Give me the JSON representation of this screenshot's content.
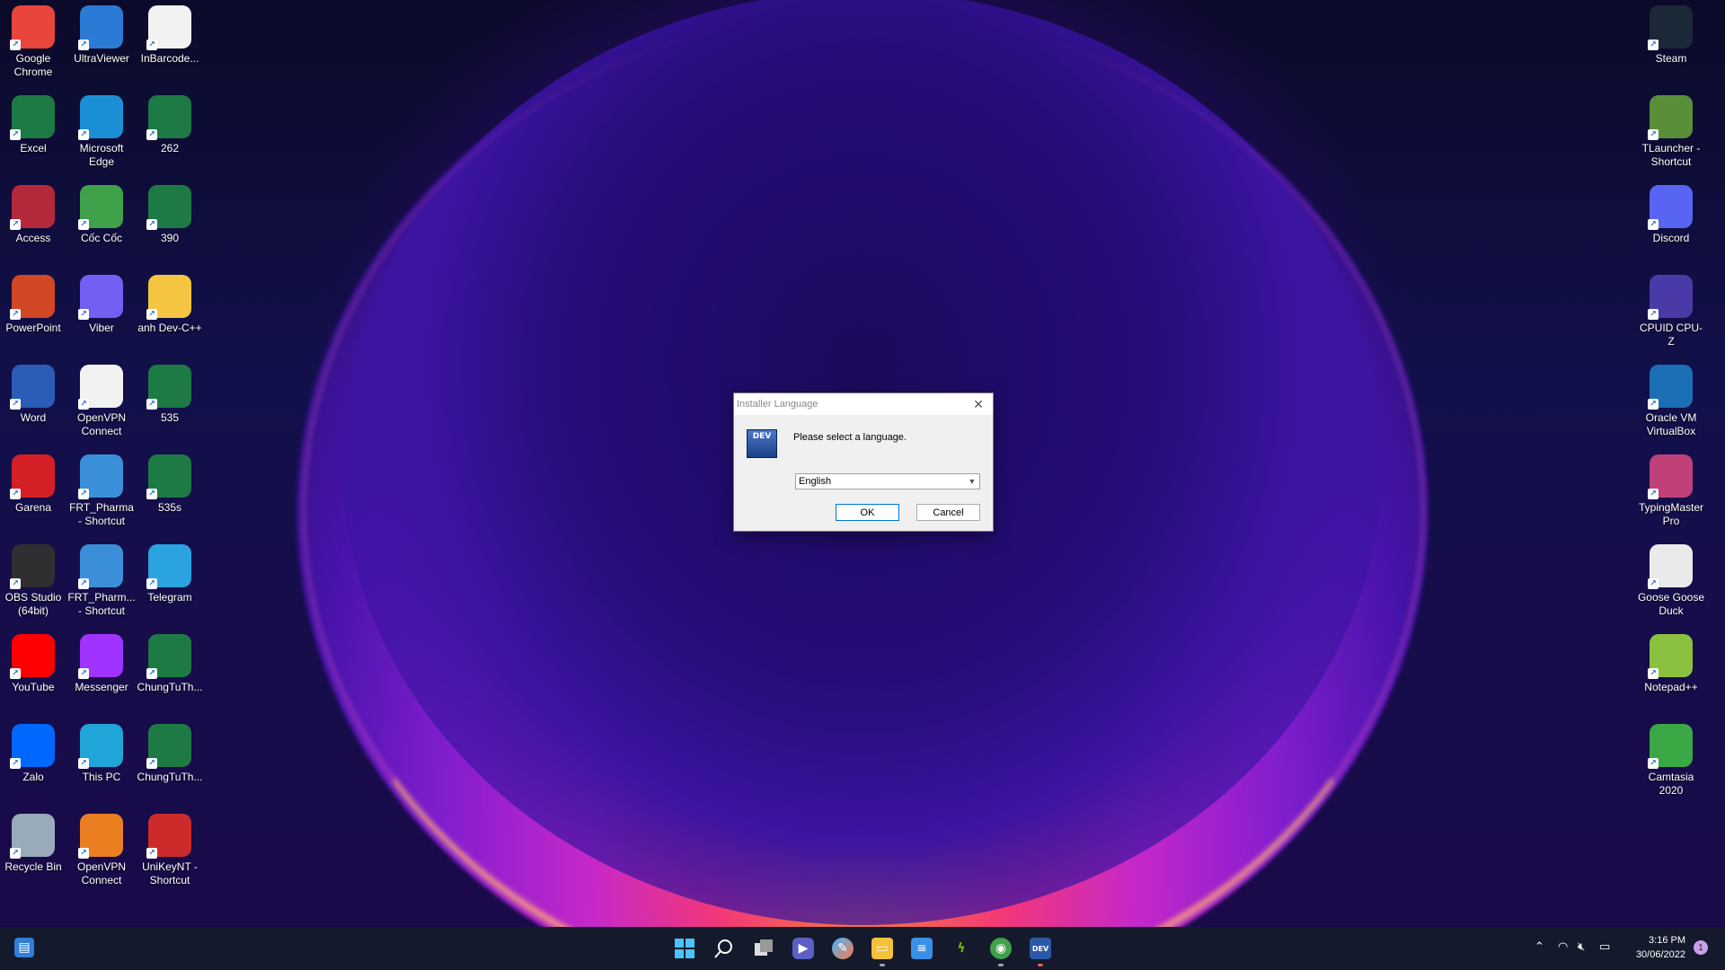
{
  "desktop_icons": [
    {
      "label": "Google Chrome",
      "icon": "chrome-icon",
      "color": "#e8453c"
    },
    {
      "label": "UltraViewer",
      "icon": "ultraviewer-icon",
      "color": "#2b7bd6"
    },
    {
      "label": "InBarcode...",
      "icon": "file-icon",
      "color": "#f2f2f2"
    },
    {
      "label": "Excel",
      "icon": "excel-icon",
      "color": "#1d7a45"
    },
    {
      "label": "Microsoft Edge",
      "icon": "edge-icon",
      "color": "#1b8fd6"
    },
    {
      "label": "262",
      "icon": "excel-file-icon",
      "color": "#1d7a45"
    },
    {
      "label": "Access",
      "icon": "access-icon",
      "color": "#b3283a"
    },
    {
      "label": "Cốc Cốc",
      "icon": "coccoc-icon",
      "color": "#3fa14a"
    },
    {
      "label": "390",
      "icon": "excel-file-icon",
      "color": "#1d7a45"
    },
    {
      "label": "PowerPoint",
      "icon": "powerpoint-icon",
      "color": "#d24726"
    },
    {
      "label": "Viber",
      "icon": "viber-icon",
      "color": "#7360f2"
    },
    {
      "label": "anh Dev-C++",
      "icon": "folder-icon",
      "color": "#f5c542"
    },
    {
      "label": "Word",
      "icon": "word-icon",
      "color": "#2b5cb8"
    },
    {
      "label": "OpenVPN Connect",
      "icon": "file-icon",
      "color": "#f2f2f2"
    },
    {
      "label": "535",
      "icon": "excel-file-icon",
      "color": "#1d7a45"
    },
    {
      "label": "Garena",
      "icon": "garena-icon",
      "color": "#d41f26"
    },
    {
      "label": "FRT_Pharma - Shortcut",
      "icon": "frt-pharma-icon",
      "color": "#3b8fd8"
    },
    {
      "label": "535s",
      "icon": "excel-file-icon",
      "color": "#1d7a45"
    },
    {
      "label": "OBS Studio (64bit)",
      "icon": "obs-icon",
      "color": "#302e31"
    },
    {
      "label": "FRT_Pharm... - Shortcut",
      "icon": "frt-pharma-icon",
      "color": "#3b8fd8"
    },
    {
      "label": "Telegram",
      "icon": "telegram-icon",
      "color": "#2aa3e0"
    },
    {
      "label": "YouTube",
      "icon": "youtube-icon",
      "color": "#ff0000"
    },
    {
      "label": "Messenger",
      "icon": "messenger-icon",
      "color": "#a033ff"
    },
    {
      "label": "ChungTuTh...",
      "icon": "excel-file-icon",
      "color": "#1d7a45"
    },
    {
      "label": "Zalo",
      "icon": "zalo-icon",
      "color": "#0068ff"
    },
    {
      "label": "This PC",
      "icon": "this-pc-icon",
      "color": "#1fa5d8"
    },
    {
      "label": "ChungTuTh...",
      "icon": "excel-file-icon",
      "color": "#1d7a45"
    },
    {
      "label": "Recycle Bin",
      "icon": "recycle-bin-icon",
      "color": "#9ab"
    },
    {
      "label": "OpenVPN Connect",
      "icon": "openvpn-icon",
      "color": "#ea7e20"
    },
    {
      "label": "UniKeyNT - Shortcut",
      "icon": "unikey-icon",
      "color": "#cc2b2b"
    }
  ],
  "desktop_icons_right": [
    {
      "label": "Steam",
      "icon": "steam-icon",
      "color": "#1b2838"
    },
    {
      "label": "TLauncher - Shortcut",
      "icon": "tlauncher-icon",
      "color": "#5a8f3a"
    },
    {
      "label": "Discord",
      "icon": "discord-icon",
      "color": "#5865f2"
    },
    {
      "label": "CPUID CPU-Z",
      "icon": "cpuz-icon",
      "color": "#4a3aa8"
    },
    {
      "label": "Oracle VM VirtualBox",
      "icon": "virtualbox-icon",
      "color": "#1c6fb5"
    },
    {
      "label": "TypingMaster Pro",
      "icon": "typingmaster-icon",
      "color": "#c0407a"
    },
    {
      "label": "Goose Goose Duck",
      "icon": "goose-icon",
      "color": "#eaeaea"
    },
    {
      "label": "Notepad++",
      "icon": "notepadpp-icon",
      "color": "#8ac23f"
    },
    {
      "label": "Camtasia 2020",
      "icon": "camtasia-icon",
      "color": "#3aa844"
    }
  ],
  "dialog": {
    "title": "Installer Language",
    "prompt": "Please select a language.",
    "selected_language": "English",
    "ok_label": "OK",
    "cancel_label": "Cancel",
    "logo_text": "DEV"
  },
  "taskbar": {
    "apps": [
      "windows-start-icon",
      "search-icon",
      "task-view-icon",
      "teams-chat-icon",
      "paint-icon",
      "file-explorer-icon",
      "notepad-icon",
      "nvidia-icon",
      "coccoc-taskbar-icon",
      "devcpp-taskbar-icon"
    ],
    "time": "3:16 PM",
    "date": "30/06/2022",
    "notification_count": "1"
  }
}
